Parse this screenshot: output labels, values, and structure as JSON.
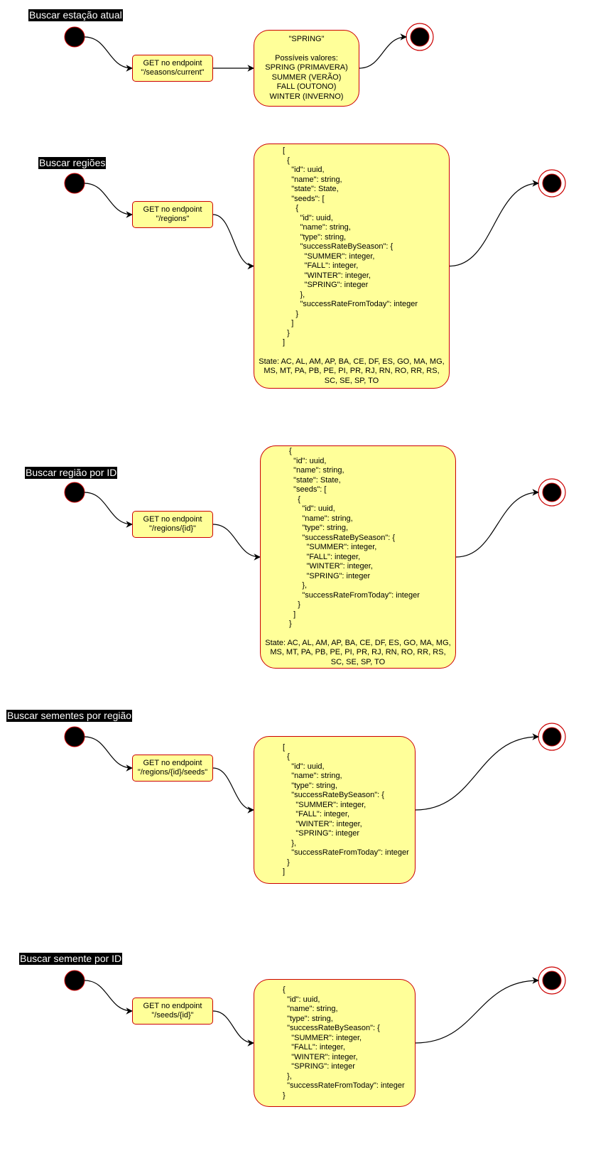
{
  "colors": {
    "fill": "#ffff99",
    "stroke": "#cc0000",
    "title_bg": "#000000",
    "title_fg": "#ffffff",
    "node": "#000000"
  },
  "flows": [
    {
      "title": "Buscar estação atual",
      "action": "GET no endpoint\n\"/seasons/current\"",
      "result": "\"SPRING\"\n\nPossíveis valores:\nSPRING (PRIMAVERA)\nSUMMER (VERÃO)\nFALL (OUTONO)\nWINTER (INVERNO)",
      "states": ""
    },
    {
      "title": "Buscar regiões",
      "action": "GET no endpoint\n\"/regions\"",
      "result": "[\n  {\n    \"id\": uuid,\n    \"name\": string,\n    \"state\": State,\n    \"seeds\": [\n      {\n        \"id\": uuid,\n        \"name\": string,\n        \"type\": string,\n        \"successRateBySeason\": {\n          \"SUMMER\": integer,\n          \"FALL\": integer,\n          \"WINTER\": integer,\n          \"SPRING\": integer\n        },\n        \"successRateFromToday\": integer\n      }\n    ]\n  }\n]",
      "states": "State: AC, AL, AM, AP, BA, CE, DF, ES, GO, MA, MG,\nMS, MT, PA, PB, PE, PI, PR, RJ, RN, RO, RR, RS,\nSC, SE, SP, TO"
    },
    {
      "title": "Buscar região por ID",
      "action": "GET no endpoint\n\"/regions/{id}\"",
      "result": "{\n  \"id\": uuid,\n  \"name\": string,\n  \"state\": State,\n  \"seeds\": [\n    {\n      \"id\": uuid,\n      \"name\": string,\n      \"type\": string,\n      \"successRateBySeason\": {\n        \"SUMMER\": integer,\n        \"FALL\": integer,\n        \"WINTER\": integer,\n        \"SPRING\": integer\n      },\n      \"successRateFromToday\": integer\n    }\n  ]\n}",
      "states": "State: AC, AL, AM, AP, BA, CE, DF, ES, GO, MA, MG,\nMS, MT, PA, PB, PE, PI, PR, RJ, RN, RO, RR, RS,\nSC, SE, SP, TO"
    },
    {
      "title": "Buscar sementes por região",
      "action": "GET no endpoint\n\"/regions/{id}/seeds\"",
      "result": "[\n  {\n    \"id\": uuid,\n    \"name\": string,\n    \"type\": string,\n    \"successRateBySeason\": {\n      \"SUMMER\": integer,\n      \"FALL\": integer,\n      \"WINTER\": integer,\n      \"SPRING\": integer\n    },\n    \"successRateFromToday\": integer\n  }\n]",
      "states": ""
    },
    {
      "title": "Buscar semente por ID",
      "action": "GET no endpoint\n\"/seeds/{id}\"",
      "result": "{\n  \"id\": uuid,\n  \"name\": string,\n  \"type\": string,\n  \"successRateBySeason\": {\n    \"SUMMER\": integer,\n    \"FALL\": integer,\n    \"WINTER\": integer,\n    \"SPRING\": integer\n  },\n  \"successRateFromToday\": integer\n}",
      "states": ""
    }
  ]
}
